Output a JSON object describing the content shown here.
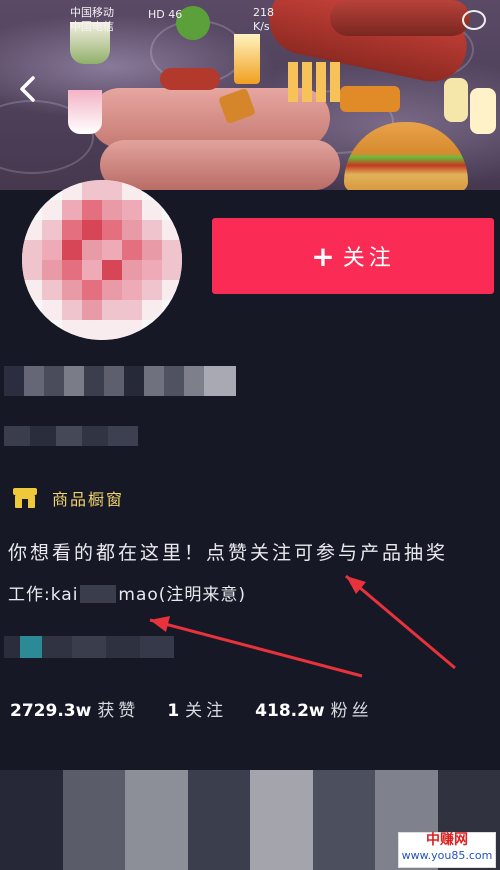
{
  "status_bar": {
    "carrier_top": "中国移动",
    "carrier_bottom": "中国电信",
    "network": "HD 46",
    "speed_value": "218",
    "speed_unit": "K/s"
  },
  "profile": {
    "follow_plus": "+",
    "follow_label": "关注"
  },
  "shop_window": {
    "label": "商品橱窗"
  },
  "bio": {
    "line1": "你想看的都在这里！点赞关注可参与产品抽奖",
    "line2_prefix": "工作:kai",
    "line2_suffix": "mao(注明来意)"
  },
  "stats": {
    "likes_value": "2729.3w",
    "likes_label": "获赞",
    "following_value": "1",
    "following_label": "关注",
    "fans_value": "418.2w",
    "fans_label": "粉丝"
  },
  "watermark": {
    "brand": "中赚网",
    "url": "www.you85.com"
  },
  "colors": {
    "follow_button": "#fa2c55",
    "background": "#161826",
    "shop_label": "#f0d36a",
    "annotation_arrow": "#e8323c"
  }
}
